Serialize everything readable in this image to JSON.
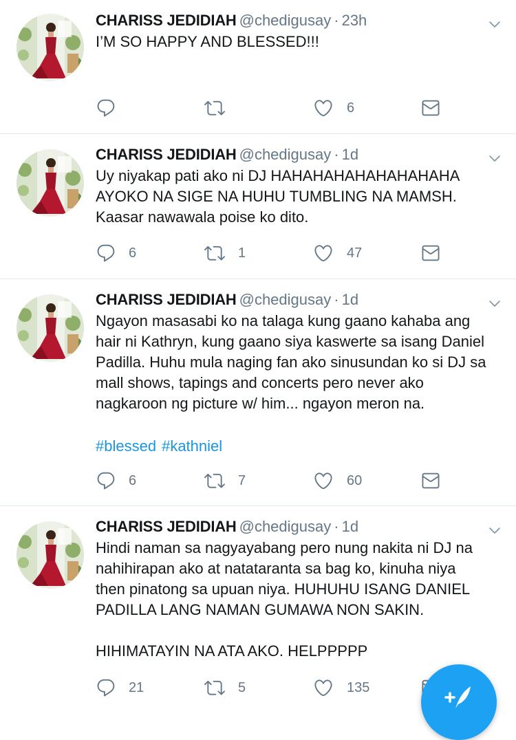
{
  "tweets": [
    {
      "name": "CHARISS JEDIDIAH",
      "handle": "@chedigusay",
      "separator": "·",
      "time": "23h",
      "text": "I’M SO HAPPY AND BLESSED!!!",
      "hashtags": [],
      "replies": "",
      "retweets": "",
      "likes": "6"
    },
    {
      "name": "CHARISS JEDIDIAH",
      "handle": "@chedigusay",
      "separator": "·",
      "time": "1d",
      "text": "Uy niyakap pati ako ni DJ HAHAHAHAHAHAHAHAHA\nAYOKO NA SIGE NA HUHU TUMBLING NA MAMSH.\nKaasar nawawala poise ko dito.",
      "hashtags": [],
      "replies": "6",
      "retweets": "1",
      "likes": "47"
    },
    {
      "name": "CHARISS JEDIDIAH",
      "handle": "@chedigusay",
      "separator": "·",
      "time": "1d",
      "text": "Ngayon masasabi ko na talaga kung gaano kahaba ang\nhair ni Kathryn, kung gaano siya kaswerte sa isang Daniel\nPadilla. Huhu mula naging fan ako sinusundan ko si DJ sa\nmall shows, tapings and concerts pero never ako\nnagkaroon ng picture w/ him... ngayon meron na.",
      "hashtags": [
        "#blessed",
        "#kathniel"
      ],
      "replies": "6",
      "retweets": "7",
      "likes": "60"
    },
    {
      "name": "CHARISS JEDIDIAH",
      "handle": "@chedigusay",
      "separator": "·",
      "time": "1d",
      "text": "Hindi naman sa nagyayabang pero nung nakita ni DJ na\nnahihirapan ako at natataranta sa bag ko, kinuha niya\nthen pinatong sa upuan niya. HUHUHU ISANG DANIEL\nPADILLA LANG NAMAN GUMAWA NON SAKIN.\n\nHIHIMATAYIN NA ATA AKO. HELPPPPP",
      "hashtags": [],
      "replies": "21",
      "retweets": "5",
      "likes": "135"
    }
  ],
  "icons": {
    "reply": "reply-icon",
    "retweet": "retweet-icon",
    "like": "heart-icon",
    "dm": "envelope-icon",
    "more": "chevron-down-icon",
    "compose": "compose-tweet-icon"
  },
  "colors": {
    "accent": "#1da1f2",
    "hashtag": "#1b95e0",
    "secondary_text": "#657786",
    "divider": "#e1e8ed",
    "avatar_dress": "#a0142a"
  }
}
